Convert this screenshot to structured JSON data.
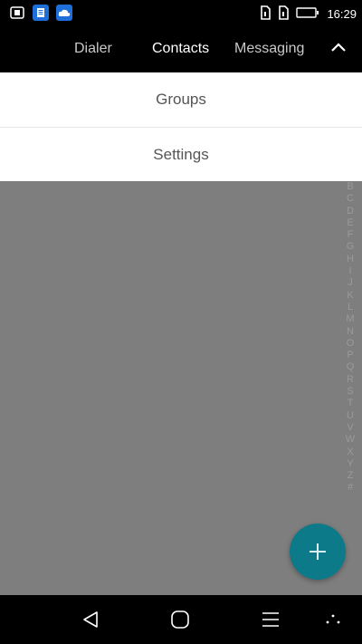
{
  "status_bar": {
    "time": "16:29",
    "left_icons": [
      "screenshot-icon",
      "app-icon-doc",
      "cloud-icon"
    ],
    "right_icons": [
      "sim1-icon",
      "sim2-icon",
      "battery-icon"
    ]
  },
  "tabs": [
    {
      "label": "Dialer",
      "active": false
    },
    {
      "label": "Contacts",
      "active": true
    },
    {
      "label": "Messaging",
      "active": false
    }
  ],
  "collapse_icon": "chevron-up-icon",
  "menu": {
    "items": [
      {
        "label": "Groups"
      },
      {
        "label": "Settings"
      }
    ]
  },
  "alphabet_index": [
    "B",
    "C",
    "D",
    "E",
    "F",
    "G",
    "H",
    "I",
    "J",
    "K",
    "L",
    "M",
    "N",
    "O",
    "P",
    "Q",
    "R",
    "S",
    "T",
    "U",
    "V",
    "W",
    "X",
    "Y",
    "Z",
    "#"
  ],
  "fab": {
    "icon": "plus-icon",
    "color": "#0d7a8a"
  },
  "nav_bar": {
    "icons": [
      "back-icon",
      "home-icon",
      "menu-icon",
      "more-icon"
    ]
  },
  "colors": {
    "overlay": "#7e7e7e",
    "accent": "#0d7a8a"
  }
}
